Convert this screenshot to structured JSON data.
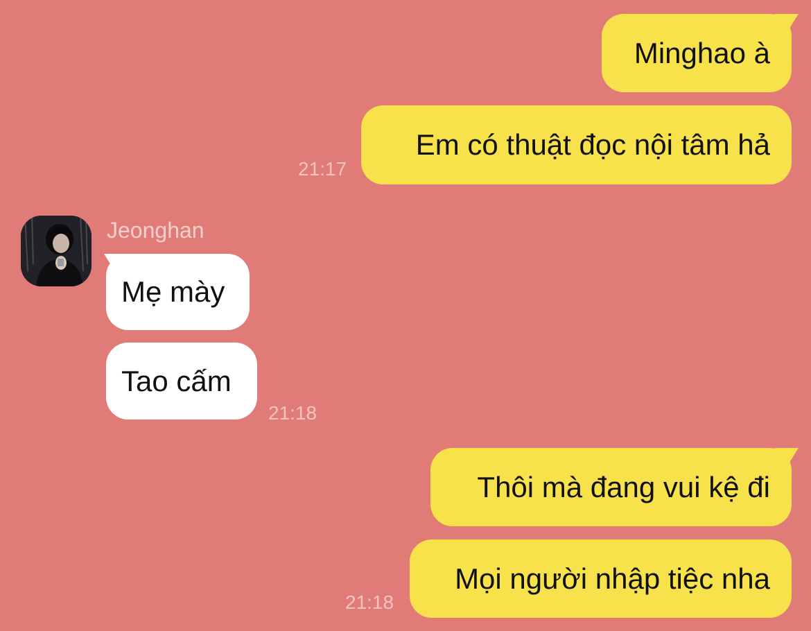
{
  "contact": {
    "name": "Jeonghan"
  },
  "messages": [
    {
      "side": "out",
      "text": "Minghao à"
    },
    {
      "side": "out",
      "text": "Em có thuật đọc nội tâm hả",
      "time": "21:17"
    },
    {
      "side": "in",
      "text": "Mẹ mày"
    },
    {
      "side": "in",
      "text": "Tao cấm",
      "time": "21:18"
    },
    {
      "side": "out",
      "text": "Thôi mà đang vui kệ đi"
    },
    {
      "side": "out",
      "text": "Mọi người nhập tiệc nha",
      "time": "21:18"
    }
  ],
  "colors": {
    "background": "#e17b77",
    "outgoing_bubble": "#f8e24c",
    "incoming_bubble": "#ffffff",
    "timestamp": "#f3c4bf",
    "sender_name": "#f6cfcb"
  },
  "icons": {
    "avatar": "profile-photo"
  }
}
